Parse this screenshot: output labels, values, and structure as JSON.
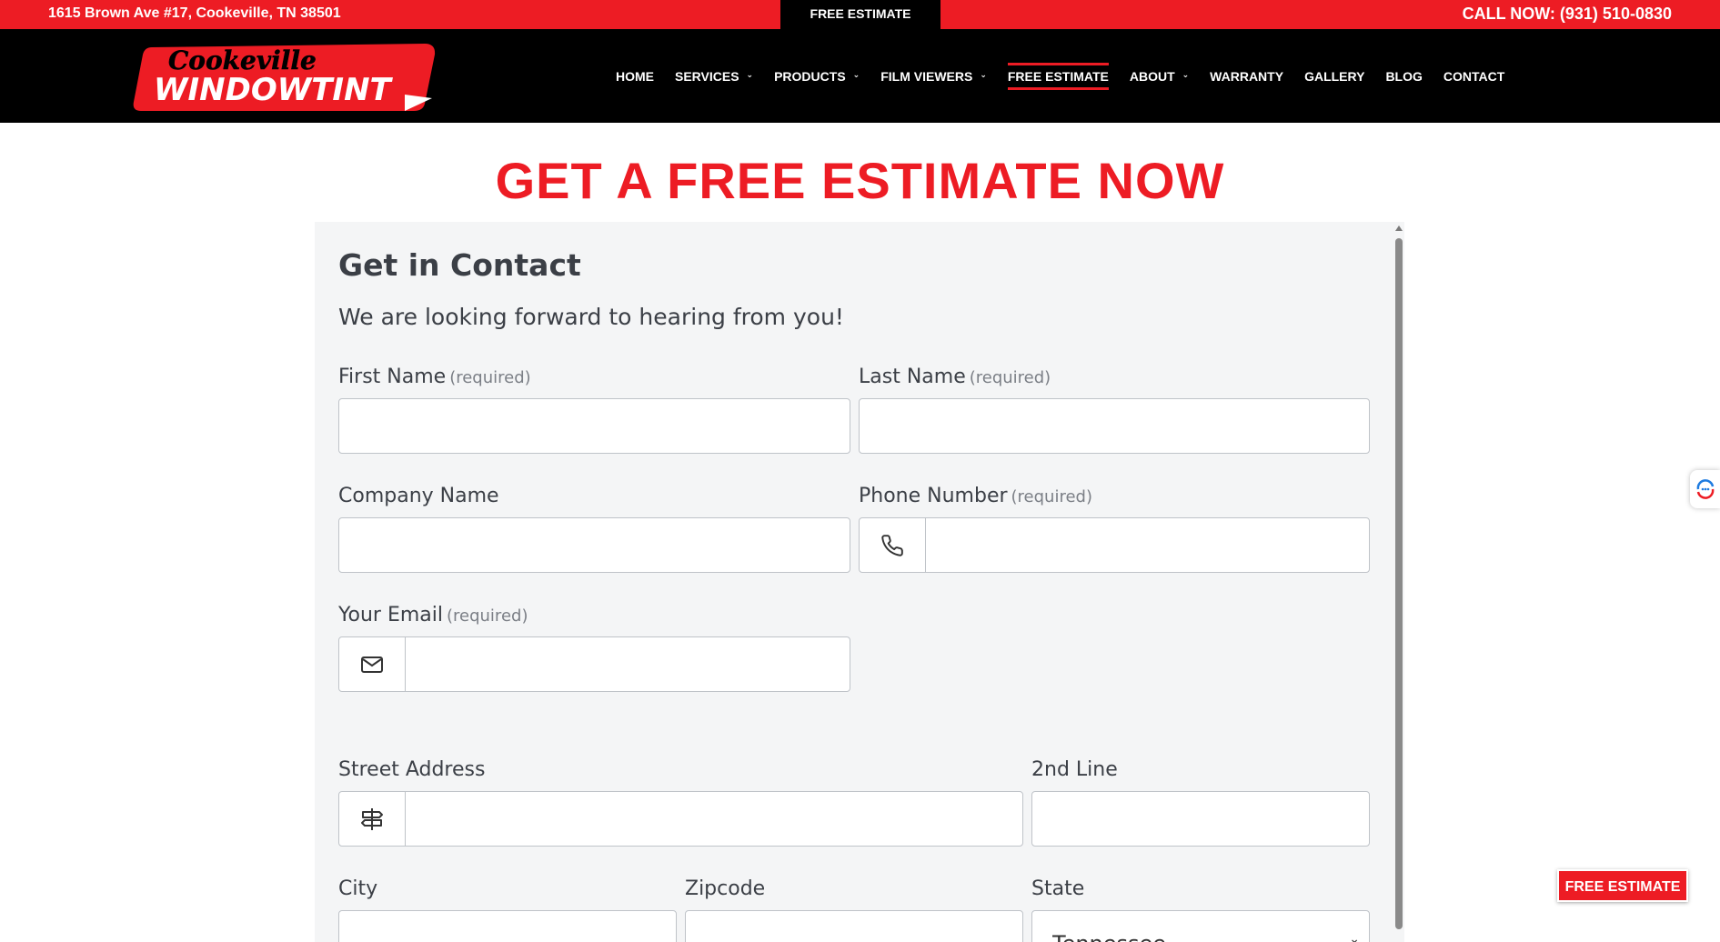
{
  "topbar": {
    "address": "1615 Brown Ave #17, Cookeville, TN 38501",
    "cta": "FREE ESTIMATE",
    "call": "CALL NOW: (931) 510-0830"
  },
  "logo": {
    "line1": "Cookeville",
    "line2": "WINDOWTINT"
  },
  "nav": {
    "items": [
      {
        "label": "HOME",
        "dropdown": false
      },
      {
        "label": "SERVICES",
        "dropdown": true
      },
      {
        "label": "PRODUCTS",
        "dropdown": true
      },
      {
        "label": "FILM VIEWERS",
        "dropdown": true
      },
      {
        "label": "FREE ESTIMATE",
        "dropdown": false,
        "active": true
      },
      {
        "label": "ABOUT",
        "dropdown": true
      },
      {
        "label": "WARRANTY",
        "dropdown": false
      },
      {
        "label": "GALLERY",
        "dropdown": false
      },
      {
        "label": "BLOG",
        "dropdown": false
      },
      {
        "label": "CONTACT",
        "dropdown": false
      }
    ]
  },
  "hero": {
    "title": "GET A FREE ESTIMATE NOW"
  },
  "form": {
    "title": "Get in Contact",
    "subtitle": "We are looking forward to hearing from you!",
    "required_text": "(required)",
    "first_name": {
      "label": "First Name",
      "value": ""
    },
    "last_name": {
      "label": "Last Name",
      "value": ""
    },
    "company": {
      "label": "Company Name",
      "value": ""
    },
    "phone": {
      "label": "Phone Number",
      "value": ""
    },
    "email": {
      "label": "Your Email",
      "value": ""
    },
    "street": {
      "label": "Street Address",
      "value": ""
    },
    "line2": {
      "label": "2nd Line",
      "value": ""
    },
    "city": {
      "label": "City",
      "value": ""
    },
    "zipcode": {
      "label": "Zipcode",
      "value": ""
    },
    "state": {
      "label": "State",
      "value": "Tennessee"
    }
  },
  "float_cta": "FREE ESTIMATE",
  "colors": {
    "brand_red": "#ed1c24",
    "header_bg": "#000000",
    "form_bg": "#f4f5f6"
  },
  "icons": [
    "phone-icon",
    "envelope-icon",
    "signpost-icon",
    "chat-icon",
    "chevron-down-icon"
  ]
}
